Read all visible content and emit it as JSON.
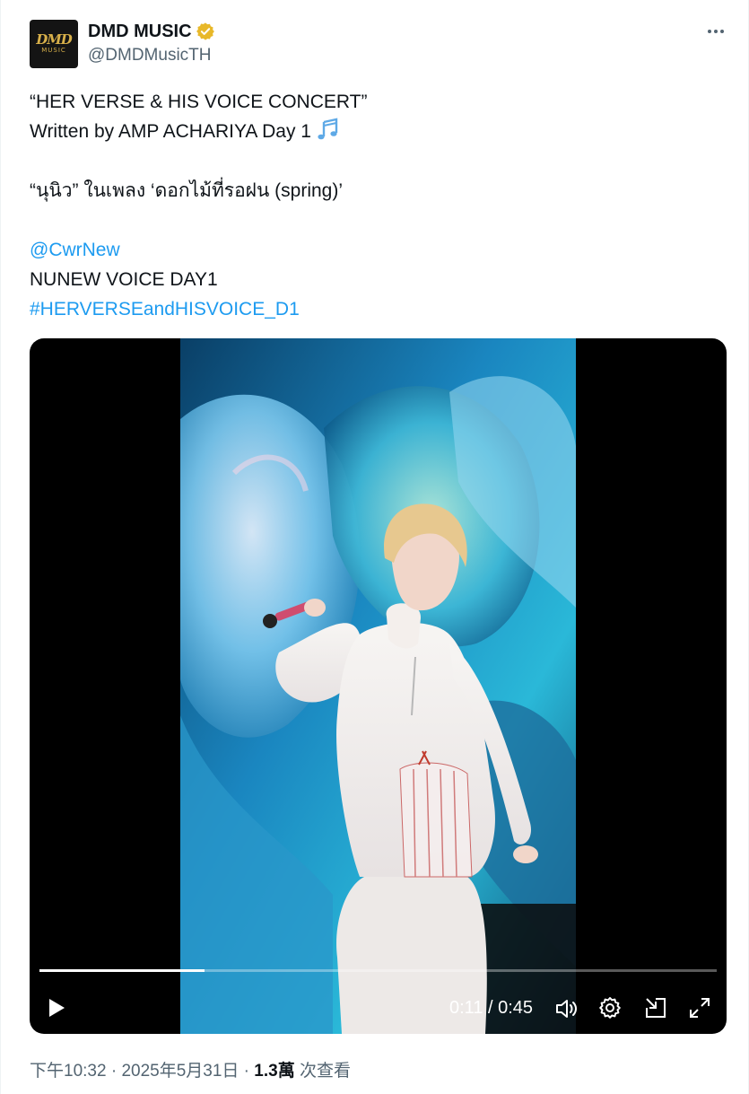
{
  "author": {
    "display_name": "DMD MUSIC",
    "handle": "@DMDMusicTH",
    "avatar_text": "DMD",
    "avatar_subtext": "MUSIC",
    "verified_color": "#e8b829"
  },
  "tweet": {
    "line1": "“HER VERSE & HIS VOICE CONCERT”",
    "line2": "Written by AMP ACHARIYA Day 1",
    "line3": "“นุนิว” ในเพลง ‘ดอกไม้ที่รอฝน (spring)’",
    "mention": "@CwrNew",
    "line5": "NUNEW VOICE DAY1",
    "hashtag": "#HERVERSEandHISVOICE_D1",
    "emoji_icon": "musical-notes-icon"
  },
  "video": {
    "current_time": "0:11",
    "separator": " / ",
    "duration": "0:45",
    "progress_fraction": 0.244,
    "icons": [
      "play-icon",
      "volume-icon",
      "settings-icon",
      "dock-icon",
      "fullscreen-icon"
    ]
  },
  "meta": {
    "time": "下午10:32",
    "dot1": " · ",
    "date": "2025年5月31日",
    "dot2": " · ",
    "views_count": "1.3萬",
    "views_label": " 次查看"
  },
  "colors": {
    "link": "#1d9bf0",
    "text": "#0f1419",
    "secondary": "#536471"
  }
}
